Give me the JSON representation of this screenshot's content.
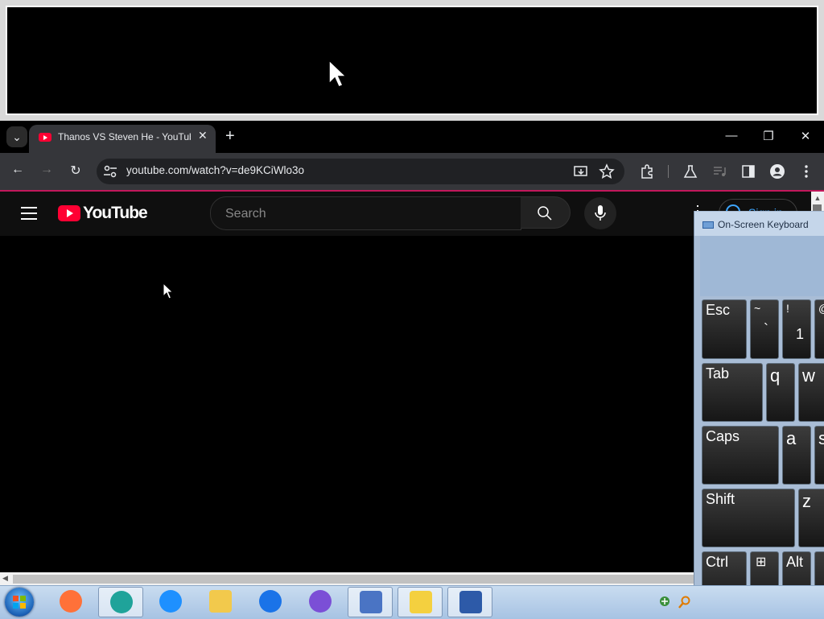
{
  "browser": {
    "tab": {
      "title": "Thanos VS Steven He - YouTube"
    },
    "new_tab_symbol": "+",
    "tab_close_symbol": "✕",
    "tab_list_symbol": "⌄",
    "window_controls": {
      "minimize": "—",
      "restore": "❐",
      "close": "✕"
    },
    "nav": {
      "back": "←",
      "forward": "→",
      "reload": "↻"
    },
    "url": "youtube.com/watch?v=de9KCiWlo3o"
  },
  "youtube": {
    "logo_text": "YouTube",
    "search": {
      "placeholder": "Search"
    },
    "more_symbol": "⋮",
    "signin_label": "Sign in"
  },
  "osk": {
    "title": "On-Screen Keyboard",
    "keys": {
      "esc": "Esc",
      "tilde_top": "~",
      "tilde_bottom": "`",
      "one_top": "!",
      "one_bottom": "1",
      "at_top": "@",
      "tab": "Tab",
      "q": "q",
      "w": "w",
      "caps": "Caps",
      "a": "a",
      "s": "s",
      "shift": "Shift",
      "z": "z",
      "ctrl": "Ctrl",
      "win": "⊞",
      "alt": "Alt"
    }
  },
  "scroll": {
    "up": "▲",
    "left": "◀"
  },
  "taskbar": {
    "apps": [
      {
        "name": "firefox",
        "color": "#ff7139"
      },
      {
        "name": "edge",
        "color": "#1fa39a"
      },
      {
        "name": "internet-explorer",
        "color": "#1e90ff"
      },
      {
        "name": "file-explorer",
        "color": "#f2c94c"
      },
      {
        "name": "chrome",
        "color": "#1a73e8"
      },
      {
        "name": "firefox-alt",
        "color": "#7b4fd6"
      },
      {
        "name": "magnifier",
        "color": "#4a74c4"
      },
      {
        "name": "tips",
        "color": "#f4d03f"
      },
      {
        "name": "on-screen-keyboard",
        "color": "#2d5aa8"
      }
    ]
  }
}
